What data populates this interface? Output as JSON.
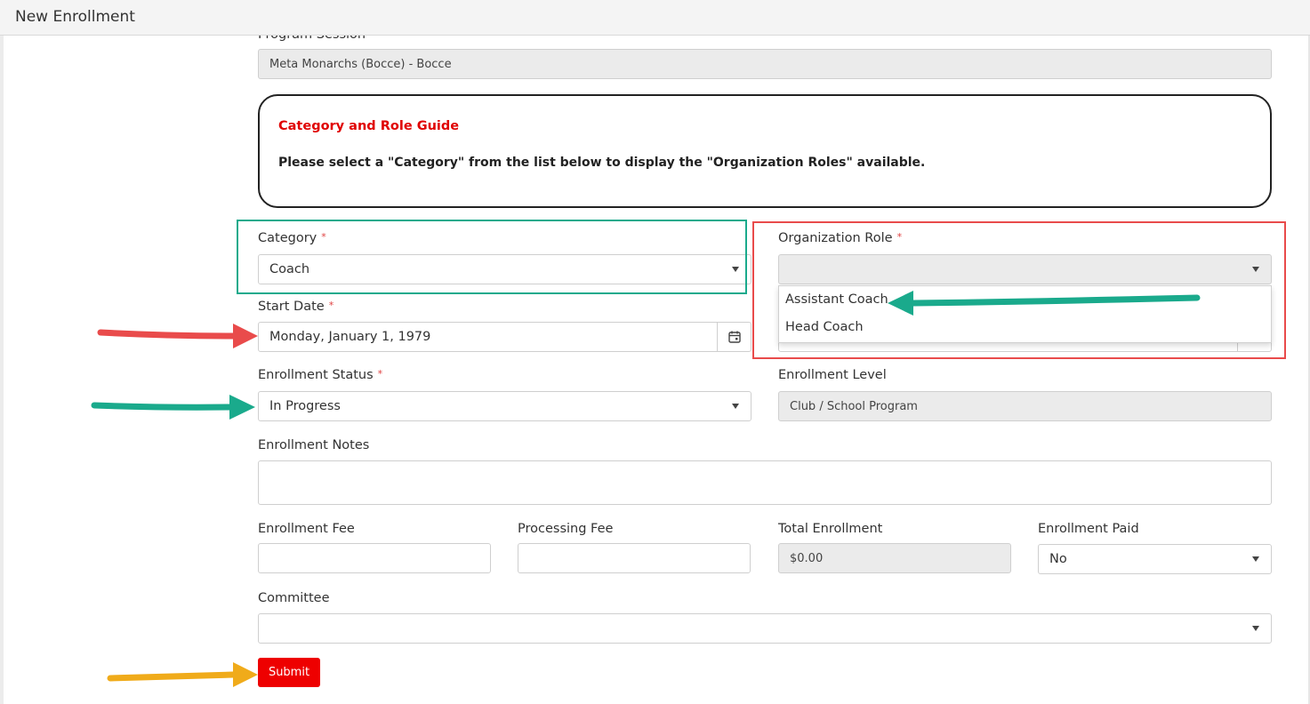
{
  "window": {
    "title": "New Enrollment"
  },
  "form": {
    "program_session": {
      "label": "Program Session",
      "value": "Meta Monarchs (Bocce) - Bocce"
    },
    "guide": {
      "title": "Category and Role Guide",
      "text": "Please select a \"Category\" from the list below to display the \"Organization Roles\" available."
    },
    "category": {
      "label": "Category",
      "value": "Coach",
      "required_mark": "*"
    },
    "organization_role": {
      "label": "Organization Role",
      "value": "",
      "required_mark": "*",
      "options": [
        "Assistant Coach",
        "Head Coach"
      ]
    },
    "start_date": {
      "label": "Start Date",
      "value": "Monday, January 1, 1979",
      "required_mark": "*",
      "icon": "calendar-icon"
    },
    "enrollment_status": {
      "label": "Enrollment Status",
      "value": "In Progress",
      "required_mark": "*"
    },
    "enrollment_level": {
      "label": "Enrollment Level",
      "value": "Club / School Program"
    },
    "enrollment_notes": {
      "label": "Enrollment Notes",
      "value": ""
    },
    "enrollment_fee": {
      "label": "Enrollment Fee",
      "value": ""
    },
    "processing_fee": {
      "label": "Processing Fee",
      "value": ""
    },
    "total_enrollment": {
      "label": "Total Enrollment",
      "value": "$0.00"
    },
    "enrollment_paid": {
      "label": "Enrollment Paid",
      "value": "No"
    },
    "committee": {
      "label": "Committee",
      "value": ""
    },
    "submit_label": "Submit"
  },
  "annotations": {
    "colors": {
      "teal": "#1aaa8c",
      "red": "#e94b4b",
      "orange": "#f0ab1a",
      "accent_red": "#ee0000"
    }
  }
}
